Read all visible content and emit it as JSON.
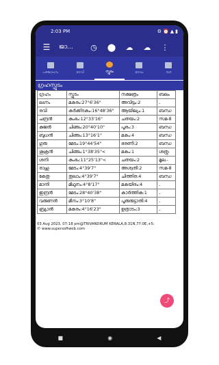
{
  "status": {
    "time": "2:03 PM",
    "icons": [
      "⚙",
      "⏰",
      "▲",
      "▮"
    ]
  },
  "toolbar": {
    "title": "ജാ..."
  },
  "tabs": [
    {
      "label": "പഞ്ചാംഗം",
      "icon": "calendar-icon"
    },
    {
      "label": "ഭാവി",
      "icon": "grid-icon"
    },
    {
      "label": "സ്ഫുടം",
      "icon": "planet-icon"
    },
    {
      "label": "ഭാവം",
      "icon": "chart-icon"
    },
    {
      "label": "ദശ",
      "icon": "book-icon"
    }
  ],
  "section": {
    "title": "ഗ്രഹസ്ഫുടം"
  },
  "table": {
    "headers": [
      "ഗ്രഹം",
      "സ്ഫുടം",
      "നക്ഷത്രം",
      "ബലം"
    ],
    "rows": [
      [
        "ലഗ്നം",
        "മകരം:27°6'36\"",
        "അവിട്ടം:2",
        "-"
      ],
      [
        "രവി",
        "കർക്കിടകം:16°48'36\"",
        "ആയില്യം:1",
        "ബന്ധ"
      ],
      [
        "ചന്ദ്രൻ",
        "കുംഭം:12°33'16\"",
        "ചതയം:2",
        "സമ-8"
      ],
      [
        "കുജൻ",
        "ചിങ്ങം:20°40'10\"",
        "പൂരം:3",
        "ബന്ധ"
      ],
      [
        "ബുധൻ",
        "ചിങ്ങം:13°16'1\"",
        "മകം:4",
        "ബന്ധ"
      ],
      [
        "ഗുരു",
        "മേടം:19°44'54\"",
        "ഭരണി:2",
        "ബന്ധ"
      ],
      [
        "ശുക്രൻ",
        "ചിങ്ങം:1°38'35\"<",
        "മകം:1",
        "ശത്രു-"
      ],
      [
        "ശനി",
        "കുംഭം:11°25'13\"<",
        "ചതയം:2",
        "മൂല.-"
      ],
      [
        "രാഹു",
        "മേടം:4°39'7\"",
        "അശ്വതി:2",
        "സമ-8"
      ],
      [
        "കേതു",
        "തുലാം:4°39'7\"",
        "ചിത്തിര:4",
        "ബന്ധ"
      ],
      [
        "മാന്ദി",
        "മിഥുനം:4°8'17\"",
        "മകയിരം:4",
        "-"
      ],
      [
        "ഇന്ദ്രൻ",
        "മേടം:28°40'38\"",
        "കാർത്തിക:1",
        "-"
      ],
      [
        "വരുണൻ",
        "മീനം:3°10'8\"",
        "പൂരുരുട്ടാതി:4",
        "-"
      ],
      [
        "ബ്ര്യാൻ",
        "മകരം:4°16'23\"",
        "ഉത്രാടം:3",
        "-"
      ]
    ]
  },
  "footer": {
    "line1": "03 Aug 2023, 07:18 pm@TRIVANDRUM KERALA,8:31N,77:0E,+5:",
    "line2": "© www.supersoftweb.com"
  }
}
